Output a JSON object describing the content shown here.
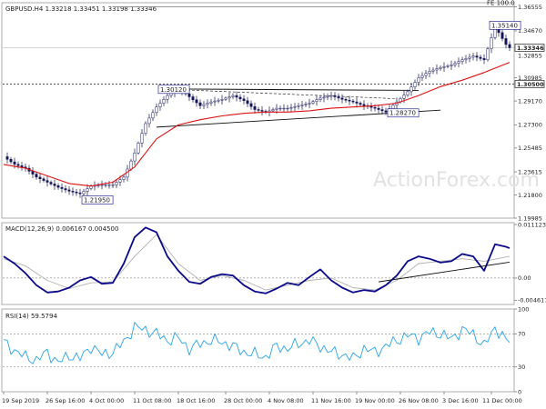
{
  "chart_data": [
    {
      "type": "line",
      "panel": "price",
      "title": "GBPUSD.H4  1.33218 1.33451 1.33198 1.33346",
      "ylim": [
        1.19985,
        1.36875
      ],
      "y_ticks": [
        1.36555,
        1.3467,
        1.30985,
        1.2917,
        1.273,
        1.25485,
        1.23615,
        1.218,
        1.19985
      ],
      "y_tick_labels": [
        "1.36555",
        "1.34670",
        "1.30985",
        "1.29170",
        "1.27300",
        "1.25485",
        "1.23615",
        "1.21800",
        "1.19985"
      ],
      "current_price": 1.33346,
      "current_price_label": "1.33346",
      "current_sub_label": "1.32855",
      "support_level": 1.305,
      "support_level_label": "1.30500",
      "fe_label": "FE 100.0",
      "fe_level": 1.3655,
      "annotations": [
        {
          "text": "1.30120",
          "bar": 43,
          "value": 1.3012
        },
        {
          "text": "1.21950",
          "bar": 22,
          "value": 1.2195
        },
        {
          "text": "1.28270",
          "bar": 106,
          "value": 1.2827
        },
        {
          "text": "1.35140",
          "bar": 134,
          "value": 1.3514
        }
      ],
      "series": [
        {
          "key": "close",
          "x": [
            0,
            3,
            6,
            9,
            12,
            15,
            18,
            21,
            24,
            27,
            30,
            33,
            36,
            39,
            42,
            45,
            48,
            51,
            54,
            57,
            60,
            63,
            66,
            69,
            72,
            75,
            78,
            81,
            84,
            87,
            90,
            93,
            96,
            99,
            102,
            105,
            108,
            111,
            114,
            117,
            120,
            123,
            126,
            129,
            132,
            135,
            138,
            139
          ],
          "y": [
            1.248,
            1.242,
            1.239,
            1.232,
            1.228,
            1.224,
            1.221,
            1.219,
            1.225,
            1.226,
            1.226,
            1.232,
            1.251,
            1.274,
            1.287,
            1.296,
            1.302,
            1.295,
            1.288,
            1.291,
            1.293,
            1.296,
            1.292,
            1.285,
            1.283,
            1.286,
            1.286,
            1.288,
            1.29,
            1.294,
            1.296,
            1.293,
            1.291,
            1.288,
            1.286,
            1.283,
            1.291,
            1.299,
            1.31,
            1.315,
            1.318,
            1.32,
            1.324,
            1.327,
            1.324,
            1.35,
            1.336,
            1.3335
          ]
        },
        {
          "key": "ma",
          "x": [
            0,
            6,
            12,
            18,
            24,
            30,
            36,
            42,
            48,
            54,
            60,
            66,
            72,
            78,
            84,
            90,
            96,
            102,
            108,
            114,
            120,
            126,
            132,
            139
          ],
          "y": [
            1.242,
            1.239,
            1.233,
            1.227,
            1.225,
            1.228,
            1.24,
            1.262,
            1.273,
            1.277,
            1.28,
            1.282,
            1.283,
            1.283,
            1.284,
            1.286,
            1.287,
            1.288,
            1.29,
            1.296,
            1.303,
            1.308,
            1.314,
            1.322
          ]
        }
      ],
      "x_ticks": [
        {
          "bar": 0,
          "label": "19 Sep 2019"
        },
        {
          "bar": 12,
          "label": "26 Sep 16:00"
        },
        {
          "bar": 24,
          "label": "4 Oct 00:00"
        },
        {
          "bar": 36,
          "label": "11 Oct 08:00"
        },
        {
          "bar": 48,
          "label": "18 Oct 16:00"
        },
        {
          "bar": 61,
          "label": "28 Oct 00:00"
        },
        {
          "bar": 73,
          "label": "4 Nov 08:00"
        },
        {
          "bar": 85,
          "label": "11 Nov 16:00"
        },
        {
          "bar": 97,
          "label": "19 Nov 00:00"
        },
        {
          "bar": 109,
          "label": "26 Nov 08:00"
        },
        {
          "bar": 121,
          "label": "3 Dec 16:00"
        },
        {
          "bar": 134,
          "label": "11 Dec 00:00"
        }
      ]
    },
    {
      "type": "line",
      "panel": "macd",
      "title": "MACD(12,26,9) 0.006167 0.004500",
      "ylim": [
        -0.0055,
        0.0115
      ],
      "y_ticks": [
        0.011123,
        0.0,
        -0.004617
      ],
      "y_tick_labels": [
        "0.011123",
        "0.00",
        "-0.004617"
      ],
      "series": [
        {
          "key": "macd",
          "x": [
            0,
            3,
            6,
            9,
            12,
            15,
            18,
            21,
            24,
            27,
            30,
            33,
            36,
            39,
            42,
            45,
            48,
            51,
            54,
            57,
            60,
            63,
            66,
            69,
            72,
            75,
            78,
            81,
            84,
            87,
            90,
            93,
            96,
            99,
            102,
            105,
            108,
            111,
            114,
            117,
            120,
            123,
            126,
            129,
            132,
            135,
            138,
            139
          ],
          "y": [
            0.0045,
            0.003,
            0.001,
            -0.0015,
            -0.003,
            -0.0028,
            -0.002,
            -0.0005,
            0.0002,
            -0.0012,
            -0.001,
            0.003,
            0.0085,
            0.0105,
            0.0095,
            0.0045,
            0.0015,
            -0.0008,
            -0.0012,
            0.0002,
            0.0008,
            0.0005,
            -0.0015,
            -0.0028,
            -0.0032,
            -0.0022,
            -0.001,
            -0.0015,
            0.0002,
            0.0018,
            -0.0005,
            -0.002,
            -0.003,
            -0.0025,
            -0.0028,
            -0.0015,
            0.0005,
            0.0035,
            0.0045,
            0.004,
            0.0032,
            0.0035,
            0.005,
            0.0045,
            0.0015,
            0.007,
            0.0065,
            0.0062
          ]
        },
        {
          "key": "signal",
          "x": [
            0,
            6,
            12,
            18,
            24,
            30,
            36,
            42,
            48,
            54,
            60,
            66,
            72,
            78,
            84,
            90,
            96,
            102,
            108,
            114,
            120,
            126,
            132,
            139
          ],
          "y": [
            0.004,
            0.0025,
            -0.0005,
            -0.0022,
            -0.001,
            -0.0008,
            0.0045,
            0.009,
            0.003,
            -0.0005,
            0.0005,
            -0.0005,
            -0.0025,
            -0.0015,
            -0.0005,
            0.0,
            -0.002,
            -0.0025,
            -0.0005,
            0.003,
            0.0035,
            0.004,
            0.0035,
            0.0045
          ]
        }
      ]
    },
    {
      "type": "line",
      "panel": "rsi",
      "title": "RSI(14) 59.5794",
      "ylim": [
        0,
        100
      ],
      "y_ticks": [
        100,
        70,
        30,
        0
      ],
      "y_tick_labels": [
        "100",
        "70",
        "30",
        "0"
      ],
      "series": [
        {
          "key": "rsi",
          "x": [
            0,
            3,
            6,
            9,
            12,
            15,
            18,
            21,
            24,
            27,
            30,
            33,
            36,
            39,
            42,
            45,
            48,
            51,
            54,
            57,
            60,
            63,
            66,
            69,
            72,
            75,
            78,
            81,
            84,
            87,
            90,
            93,
            96,
            99,
            102,
            105,
            108,
            111,
            114,
            117,
            120,
            123,
            126,
            129,
            132,
            135,
            138,
            139
          ],
          "y": [
            60,
            50,
            42,
            38,
            48,
            35,
            44,
            40,
            55,
            45,
            48,
            60,
            78,
            75,
            70,
            62,
            65,
            52,
            58,
            62,
            60,
            55,
            48,
            45,
            42,
            55,
            52,
            58,
            62,
            55,
            48,
            45,
            40,
            52,
            48,
            55,
            62,
            68,
            65,
            72,
            70,
            64,
            75,
            70,
            55,
            78,
            62,
            59.6
          ]
        }
      ]
    }
  ],
  "watermark": "ActionForex.com",
  "colors": {
    "price": "#14145a",
    "ma": "#dd1111",
    "macd": "#0a0a8a",
    "signal": "#b0b0b0",
    "rsi": "#2aa3e8",
    "trend": "#111111"
  }
}
